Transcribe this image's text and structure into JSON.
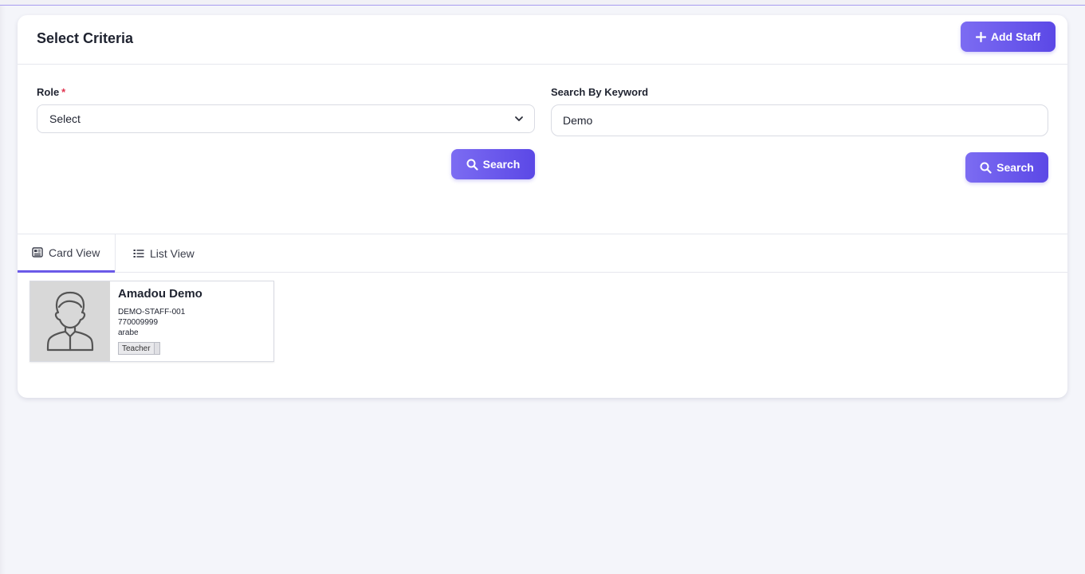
{
  "panel": {
    "title": "Select Criteria",
    "add_button_label": "Add Staff"
  },
  "filters": {
    "role_label": "Role",
    "role_required_mark": "*",
    "role_selected": "Select",
    "keyword_label": "Search By Keyword",
    "keyword_value": "Demo",
    "search_label_1": "Search",
    "search_label_2": "Search"
  },
  "tabs": [
    {
      "label": "Card View",
      "active": true,
      "icon": "card-view-icon"
    },
    {
      "label": "List View",
      "active": false,
      "icon": "list-view-icon"
    }
  ],
  "staff": [
    {
      "name": "Amadou Demo",
      "staff_id": "DEMO-STAFF-001",
      "phone": "770009999",
      "department": "arabe",
      "role_badge": "Teacher"
    }
  ],
  "colors": {
    "accent": "#6b5ae8",
    "button_gradient_start": "#7c6cf2",
    "button_gradient_end": "#5b48e6",
    "page_background": "#f4f5fa",
    "required": "#e0344f"
  }
}
